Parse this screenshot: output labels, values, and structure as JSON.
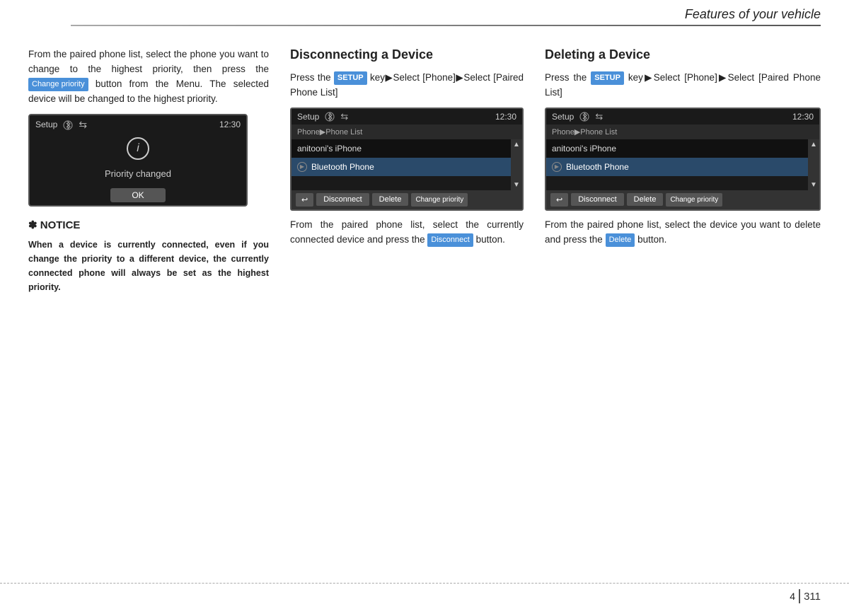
{
  "header": {
    "title": "Features of your vehicle",
    "chapter": "4",
    "page": "311"
  },
  "left": {
    "intro_text": "From the paired phone list, select the phone you want to change to the highest priority, then press the",
    "change_priority_label": "Change priority",
    "intro_text2": "button from the Menu. The selected device will be changed to the highest priority.",
    "screen": {
      "title": "Setup",
      "time": "12:30",
      "info_text": "Priority changed",
      "ok_label": "OK"
    },
    "notice_title": "✽ NOTICE",
    "notice_body": "When a device is currently connected, even if you change the priority to a different device, the currently connected phone will always be set as the highest priority."
  },
  "disconnecting": {
    "title": "Disconnecting a Device",
    "desc1": "Press the",
    "setup_label": "SETUP",
    "desc2": "key▶Select [Phone]▶Select [Paired Phone List]",
    "screen": {
      "title": "Setup",
      "time": "12:30",
      "breadcrumb": "Phone▶Phone List",
      "item1": "anitooni's iPhone",
      "item2": "Bluetooth Phone",
      "btn_back": "↩",
      "btn_disconnect": "Disconnect",
      "btn_delete": "Delete",
      "btn_change": "Change priority"
    },
    "desc3": "From the paired phone list, select the currently connected device and press the",
    "disconnect_label": "Disconnect",
    "desc4": "button."
  },
  "deleting": {
    "title": "Deleting a Device",
    "desc1": "Press the",
    "setup_label": "SETUP",
    "desc2": "key▶Select [Phone]▶Select [Paired Phone List]",
    "screen": {
      "title": "Setup",
      "time": "12:30",
      "breadcrumb": "Phone▶Phone List",
      "item1": "anitooni's iPhone",
      "item2": "Bluetooth Phone",
      "btn_back": "↩",
      "btn_disconnect": "Disconnect",
      "btn_delete": "Delete",
      "btn_change": "Change priority"
    },
    "desc3": "From the paired phone list, select the device you want to delete and press the",
    "delete_label": "Delete",
    "desc4": "button."
  }
}
